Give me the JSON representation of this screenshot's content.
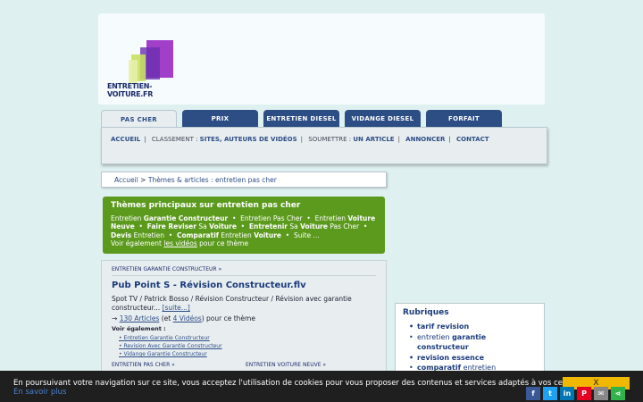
{
  "logo": {
    "text": "ENTRETIEN-VOITURE.FR"
  },
  "tabs": [
    {
      "label": "pas cher",
      "active": true
    },
    {
      "label": "prix",
      "active": false
    },
    {
      "label": "entretien diesel",
      "active": false
    },
    {
      "label": "vidange diesel",
      "active": false
    },
    {
      "label": "forfait",
      "active": false
    }
  ],
  "subnav": {
    "accueil": "ACCUEIL",
    "classement_label": "CLASSEMENT :",
    "sites": "SITES",
    "auteurs": "AUTEURS DE VIDÉOS",
    "soumettre_label": "SOUMETTRE :",
    "article": "UN ARTICLE",
    "annoncer": "ANNONCER",
    "contact": "CONTACT"
  },
  "breadcrumb": {
    "home": "Accueil",
    "sep": ">",
    "current": "Thèmes & articles : entretien pas cher"
  },
  "themes": {
    "title": "Thèmes principaux sur entretien pas cher",
    "voir_prefix": "Voir également",
    "voir_link": "les vidéos",
    "voir_suffix": "pour ce thème"
  },
  "article": {
    "category": "ENTRETIEN GARANTIE CONSTRUCTEUR »",
    "title": "Pub Point S - Révision Constructeur.flv",
    "description": "Spot TV / Patrick Bosso / Révision Constructeur / Révision avec garantie constructeur...",
    "more": "[suite...]",
    "arrow": "→",
    "articles_count": "130 Articles",
    "videos_prefix": "(et",
    "videos_count": "4 Vidéos",
    "videos_suffix": ") pour ce thème",
    "voir": "Voir également :",
    "related": [
      "Entretien Garantie Constructeur",
      "Revision Avec Garantie Constructeur",
      "Vidange Garantie Constructeur"
    ],
    "bottom_left": "ENTRETIEN PAS CHER »",
    "bottom_right": "ENTRETIEN VOITURE NEUVE »"
  },
  "rubriques": {
    "title": "Rubriques",
    "items": [
      "tarif revision",
      "entretien garantie constructeur",
      "revision essence",
      "comparatif entretien"
    ]
  },
  "cookie": {
    "text": "En poursuivant votre navigation sur ce site, vous acceptez l'utilisation de cookies pour vous proposer des contenus et services adaptés à vos centres d'intérêts.",
    "more": "En savoir plus",
    "close": "X"
  },
  "colors": {
    "tab": "#2d4d85",
    "green": "#5c9a1e",
    "accent": "#f0b800"
  }
}
